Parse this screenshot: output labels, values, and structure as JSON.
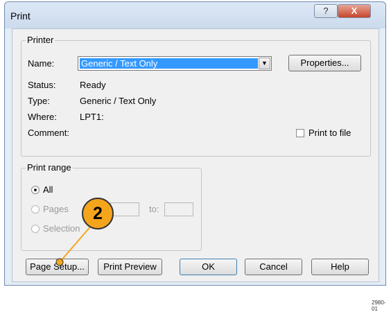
{
  "window": {
    "title": "Print",
    "help_glyph": "?",
    "close_glyph": "X"
  },
  "printer": {
    "legend": "Printer",
    "name_label": "Name:",
    "name_value": "Generic / Text Only",
    "properties_button": "Properties...",
    "status_label": "Status:",
    "status_value": "Ready",
    "type_label": "Type:",
    "type_value": "Generic / Text Only",
    "where_label": "Where:",
    "where_value": "LPT1:",
    "comment_label": "Comment:",
    "print_to_file_label": "Print to file",
    "print_to_file_checked": false
  },
  "print_range": {
    "legend": "Print range",
    "options": [
      {
        "label": "All",
        "selected": true,
        "enabled": true
      },
      {
        "label": "Pages",
        "selected": false,
        "enabled": false
      },
      {
        "label": "Selection",
        "selected": false,
        "enabled": false
      }
    ],
    "to_label": "to:"
  },
  "buttons": {
    "page_setup": "Page Setup...",
    "print_preview": "Print Preview",
    "ok": "OK",
    "cancel": "Cancel",
    "help": "Help"
  },
  "callout": {
    "number": "2",
    "color": "#f5a51c"
  },
  "footnote": "2980-01"
}
